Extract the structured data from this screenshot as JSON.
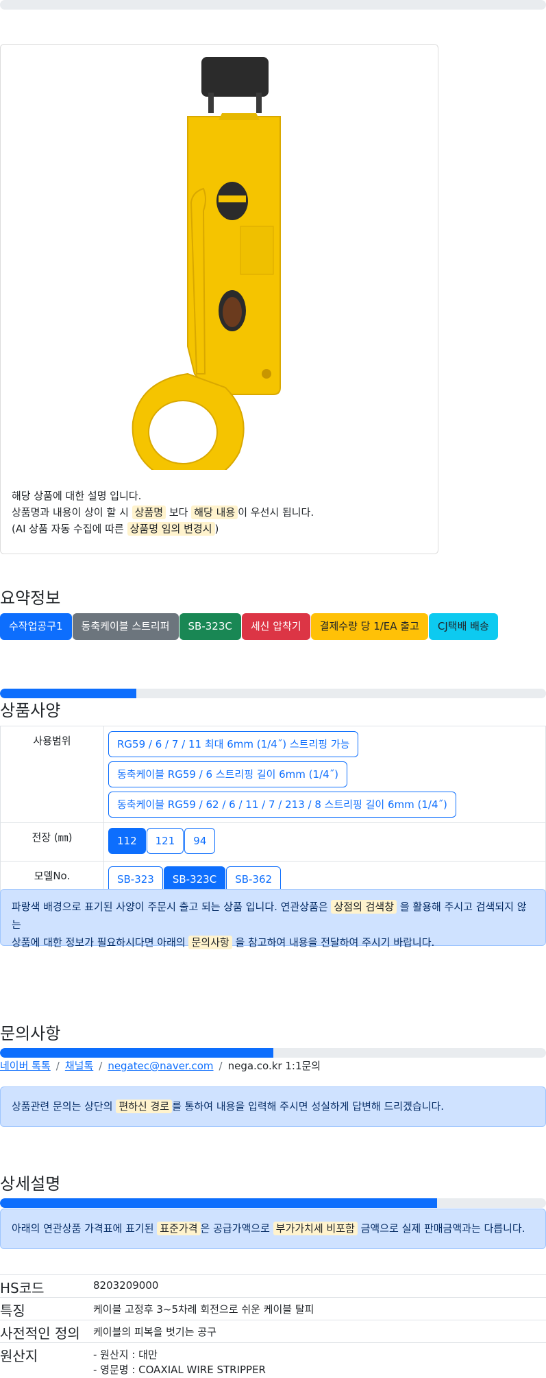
{
  "progress": {
    "top": 0,
    "spec": 0.25,
    "contact": 0.5,
    "detail": 0.8
  },
  "product": {
    "note_line1": "해당 상품에 대한 설명 입니다.",
    "note_line2_a": "상품명과 내용이 상이 할 시",
    "note_line2_b": "상품명",
    "note_line2_c": "보다",
    "note_line2_d": "해당 내용",
    "note_line2_e": "이 우선시 됩니다.",
    "note_line3_a": "(AI 상품 자동 수집에 따른",
    "note_line3_b": "상품명 임의 변경시",
    "note_line3_c": ")"
  },
  "summary": {
    "title": "요약정보",
    "badges": [
      {
        "label": "수작업공구1",
        "color": "#0d6efd"
      },
      {
        "label": "동축케이블 스트리퍼",
        "color": "#6c757d"
      },
      {
        "label": "SB-323C",
        "color": "#198754"
      },
      {
        "label": "세신 압착기",
        "color": "#dc3545"
      },
      {
        "label": "결제수량 당 1/EA 출고",
        "color": "#ffc107"
      },
      {
        "label": "CJ택배 배송",
        "color": "#0dcaf0"
      }
    ]
  },
  "spec": {
    "title": "상품사양",
    "rows": [
      {
        "label": "사용범위",
        "options": [
          "RG59 / 6 / 7 / 11 최대 6mm (1/4˝) 스트리핑 가능",
          "동축케이블 RG59 / 6 스트리핑 길이 6mm (1/4˝)",
          "동축케이블 RG59 / 62 / 6 / 11 / 7 / 213 / 8 스트리핑 길이 6mm (1/4˝)"
        ]
      },
      {
        "label": "전장 (㎜)",
        "options": [
          "112",
          "121",
          "94"
        ],
        "selected": "112"
      },
      {
        "label": "모델No.",
        "options": [
          "SB-323",
          "SB-323C",
          "SB-362"
        ],
        "selected": "SB-323C"
      }
    ],
    "alert_a": "파랑색 배경으로 표기된 사양이 주문시 출고 되는 상품 입니다. 연관상품은",
    "alert_b": "상점의 검색창",
    "alert_c": "을 활용해 주시고 검색되지 않는",
    "alert_d": "상품에 대한 정보가 필요하시다면 아래의",
    "alert_e": "문의사항",
    "alert_f": "을 참고하여 내용을 전달하여 주시기 바랍니다."
  },
  "contact": {
    "title": "문의사항",
    "links": [
      "네이버 톡톡",
      "채널톡",
      "negatec@naver.com"
    ],
    "plain": "nega.co.kr 1:1문의",
    "separator": "/",
    "alert_a": "상품관련 문의는 상단의",
    "alert_b": "편하신 경로",
    "alert_c": "를 통하여 내용을 입력해 주시면 성실하게 답변해 드리겠습니다."
  },
  "detail": {
    "title": "상세설명",
    "alert_a": "아래의 연관상품 가격표에 표기된",
    "alert_b": "표준가격",
    "alert_c": "은 공급가액으로",
    "alert_d": "부가가치세 비포함",
    "alert_e": "금액으로 실제 판매금액과는 다릅니다."
  },
  "info": {
    "hs_label": "HS코드",
    "hs_value": "8203209000",
    "feature_label": "특징",
    "feature_value": "케이블 고정후 3~5차례 회전으로 쉬운 케이블 탈피",
    "def_label": "사전적인 정의",
    "def_value": "케이블의 피복을 벗기는 공구",
    "origin_label": "원산지",
    "origin_value1": "- 원산지 : 대만",
    "origin_value2": "- 영문명 : COAXIAL WIRE STRIPPER"
  }
}
